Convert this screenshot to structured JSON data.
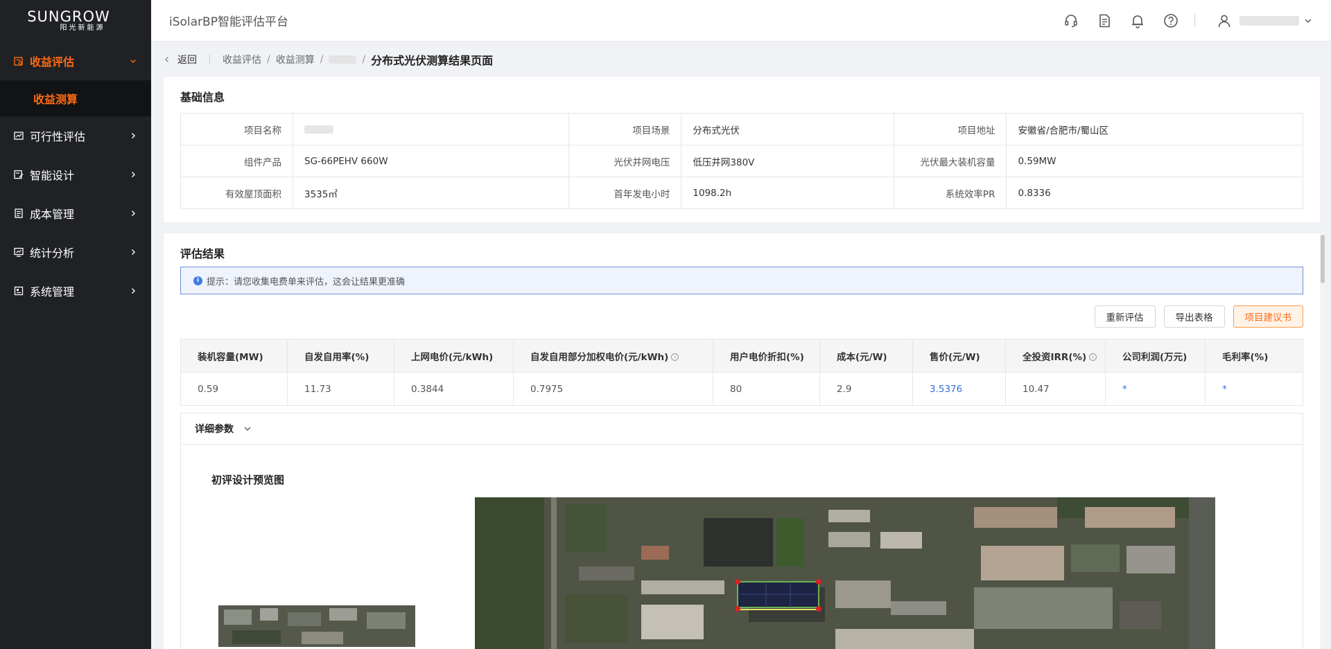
{
  "logo": {
    "brand": "SUNGROW",
    "sub": "阳光新能源"
  },
  "sidebar": {
    "items": [
      {
        "label": "收益评估",
        "icon": "evaluation-icon",
        "active": true,
        "expanded": true,
        "children": [
          {
            "label": "收益测算"
          }
        ]
      },
      {
        "label": "可行性评估",
        "icon": "chart-icon"
      },
      {
        "label": "智能设计",
        "icon": "design-icon"
      },
      {
        "label": "成本管理",
        "icon": "cost-icon"
      },
      {
        "label": "统计分析",
        "icon": "monitor-icon"
      },
      {
        "label": "系统管理",
        "icon": "system-icon"
      }
    ]
  },
  "header": {
    "title": "iSolarBP智能评估平台"
  },
  "breadcrumb": {
    "back": "返回",
    "crumb1": "收益评估",
    "crumb2": "收益测算",
    "current": "分布式光伏测算结果页面"
  },
  "basic": {
    "title": "基础信息",
    "rows": [
      [
        {
          "k": "项目名称",
          "v": ""
        },
        {
          "k": "项目场景",
          "v": "分布式光伏"
        },
        {
          "k": "项目地址",
          "v": "安徽省/合肥市/蜀山区"
        }
      ],
      [
        {
          "k": "组件产品",
          "v": "SG-66PEHV 660W"
        },
        {
          "k": "光伏并网电压",
          "v": "低压并网380V"
        },
        {
          "k": "光伏最大装机容量",
          "v": "0.59MW"
        }
      ],
      [
        {
          "k": "有效屋顶面积",
          "v": "3535㎡"
        },
        {
          "k": "首年发电小时",
          "v": "1098.2h"
        },
        {
          "k": "系统效率PR",
          "v": "0.8336"
        }
      ]
    ]
  },
  "eval": {
    "title": "评估结果",
    "tip": "提示：请您收集电费单来评估，这会让结果更准确",
    "buttons": {
      "reeval": "重新评估",
      "export": "导出表格",
      "proposal": "项目建议书"
    },
    "headers": [
      "装机容量(MW)",
      "自发自用率(%)",
      "上网电价(元/kWh)",
      "自发自用部分加权电价(元/kWh)",
      "用户电价折扣(%)",
      "成本(元/W)",
      "售价(元/W)",
      "全投资IRR(%)",
      "公司利润(万元)",
      "毛利率(%)"
    ],
    "values": [
      "0.59",
      "11.73",
      "0.3844",
      "0.7975",
      "80",
      "2.9",
      "3.5376",
      "10.47",
      "*",
      "*"
    ],
    "detail_label": "详细参数",
    "preview_title": "初评设计预览图"
  },
  "colors": {
    "accent": "#ff6a13",
    "sidebar_bg": "#1f2124",
    "link": "#2f6fd6"
  }
}
